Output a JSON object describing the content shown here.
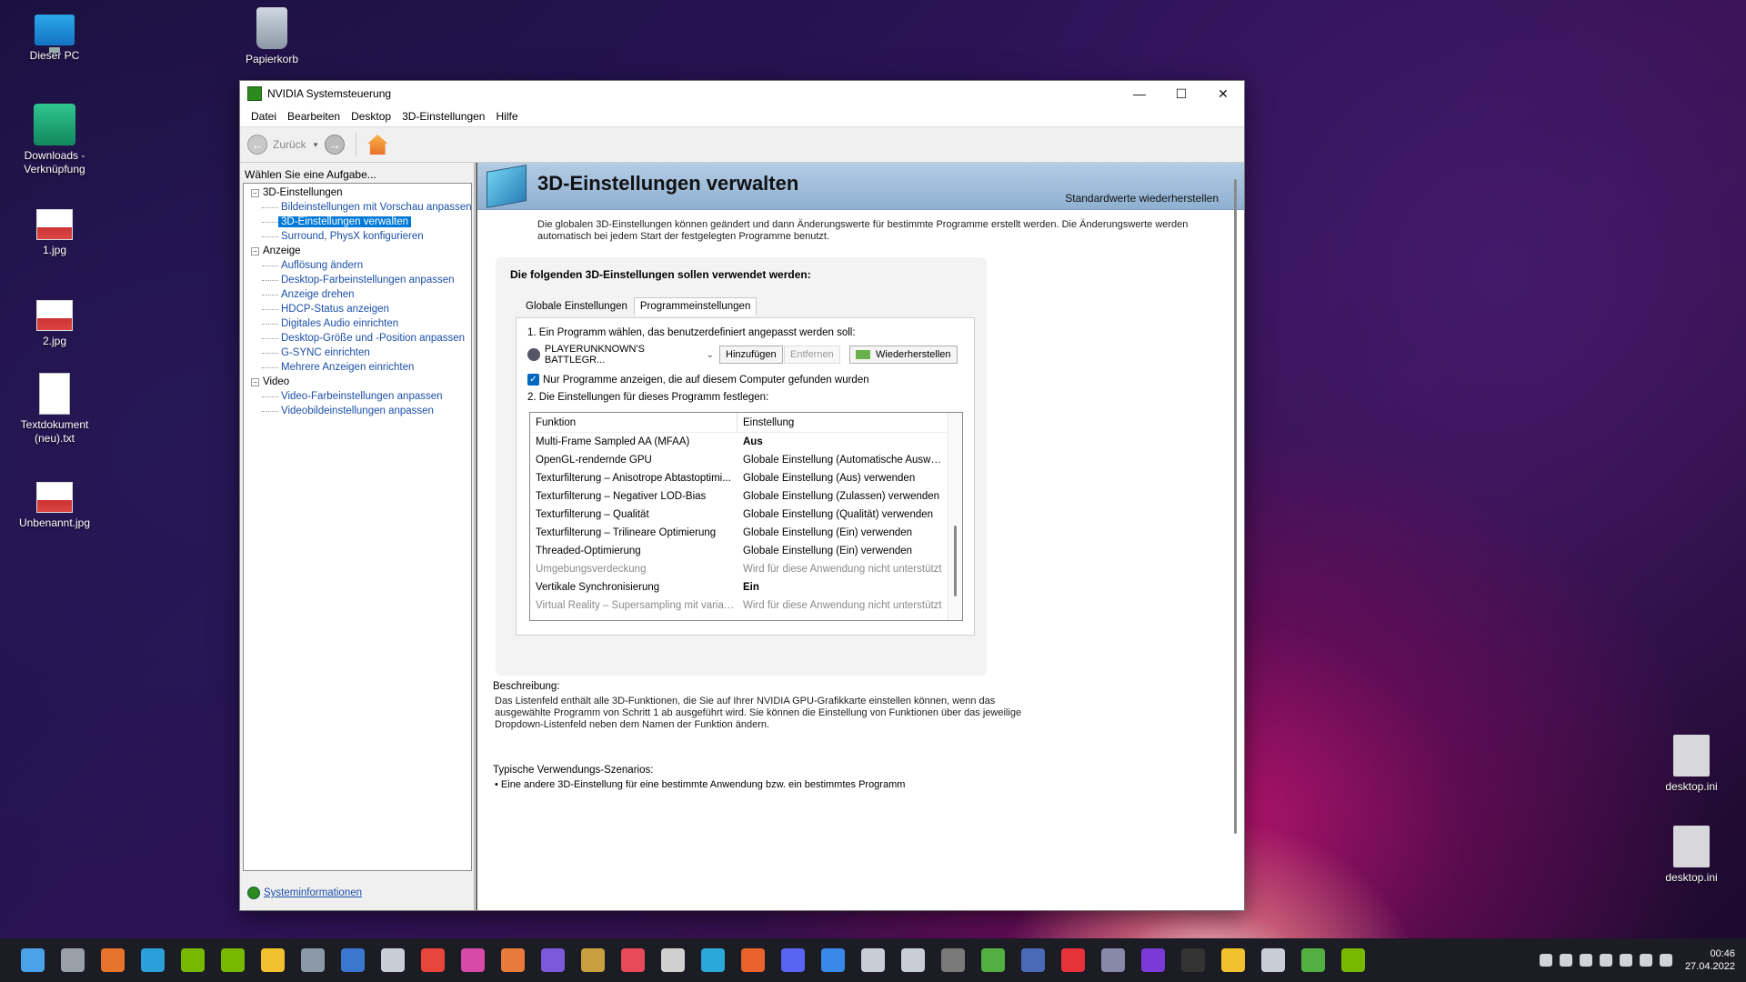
{
  "desktop": {
    "icons": [
      {
        "label": "Dieser PC"
      },
      {
        "label": "Papierkorb"
      },
      {
        "label": "Downloads - Verknüpfung"
      },
      {
        "label": "1.jpg"
      },
      {
        "label": "2.jpg"
      },
      {
        "label": "Textdokument (neu).txt"
      },
      {
        "label": "Unbenannt.jpg"
      },
      {
        "label": "desktop.ini"
      },
      {
        "label": "desktop.ini"
      }
    ]
  },
  "window": {
    "title": "NVIDIA Systemsteuerung",
    "controls": {
      "minimize": "—",
      "maximize": "☐",
      "close": "✕"
    },
    "menu": [
      "Datei",
      "Bearbeiten",
      "Desktop",
      "3D-Einstellungen",
      "Hilfe"
    ],
    "toolbar": {
      "back_label": "Zurück",
      "back_glyph": "←",
      "forward_glyph": "→",
      "dropdown_glyph": "▾"
    }
  },
  "sidebar": {
    "task_label": "Wählen Sie eine Aufgabe...",
    "categories": [
      {
        "label": "3D-Einstellungen",
        "items": [
          "Bildeinstellungen mit Vorschau anpassen",
          "3D-Einstellungen verwalten",
          "Surround, PhysX konfigurieren"
        ]
      },
      {
        "label": "Anzeige",
        "items": [
          "Auflösung ändern",
          "Desktop-Farbeinstellungen anpassen",
          "Anzeige drehen",
          "HDCP-Status anzeigen",
          "Digitales Audio einrichten",
          "Desktop-Größe und -Position anpassen",
          "G-SYNC einrichten",
          "Mehrere Anzeigen einrichten"
        ]
      },
      {
        "label": "Video",
        "items": [
          "Video-Farbeinstellungen anpassen",
          "Videobildeinstellungen anpassen"
        ]
      }
    ],
    "selected": "3D-Einstellungen verwalten",
    "tree_glyph": "−",
    "sysinfo": "Systeminformationen"
  },
  "main": {
    "title": "3D-Einstellungen verwalten",
    "reset": "Standardwerte wiederherstellen",
    "intro": "Die globalen 3D-Einstellungen können geändert und dann Änderungswerte für bestimmte Programme erstellt werden. Die Änderungswerte werden automatisch bei jedem Start der festgelegten Programme benutzt.",
    "panel_heading": "Die folgenden 3D-Einstellungen sollen verwendet werden:",
    "tabs": [
      "Globale Einstellungen",
      "Programmeinstellungen"
    ],
    "active_tab": 1,
    "step1": "1. Ein Programm wählen, das benutzerdefiniert angepasst werden soll:",
    "program": "PLAYERUNKNOWN'S BATTLEGR...",
    "caret_glyph": "⌄",
    "btn_add": "Hinzufügen",
    "btn_remove": "Entfernen",
    "btn_restore": "Wiederherstellen",
    "checkbox_label": "Nur Programme anzeigen, die auf diesem Computer gefunden wurden",
    "checkbox_glyph": "✓",
    "step2": "2. Die Einstellungen für dieses Programm festlegen:",
    "grid_headers": [
      "Funktion",
      "Einstellung"
    ],
    "grid_rows": [
      {
        "f": "Multi-Frame Sampled AA (MFAA)",
        "v": "Aus",
        "bold": true,
        "dim": false
      },
      {
        "f": "OpenGL-rendernde GPU",
        "v": "Globale Einstellung (Automatische Auswahl...",
        "bold": false,
        "dim": false
      },
      {
        "f": "Texturfilterung – Anisotrope Abtastoptimi...",
        "v": "Globale Einstellung (Aus) verwenden",
        "bold": false,
        "dim": false
      },
      {
        "f": "Texturfilterung – Negativer LOD-Bias",
        "v": "Globale Einstellung (Zulassen) verwenden",
        "bold": false,
        "dim": false
      },
      {
        "f": "Texturfilterung – Qualität",
        "v": "Globale Einstellung (Qualität) verwenden",
        "bold": false,
        "dim": false
      },
      {
        "f": "Texturfilterung – Trilineare Optimierung",
        "v": "Globale Einstellung (Ein) verwenden",
        "bold": false,
        "dim": false
      },
      {
        "f": "Threaded-Optimierung",
        "v": "Globale Einstellung (Ein) verwenden",
        "bold": false,
        "dim": false
      },
      {
        "f": "Umgebungsverdeckung",
        "v": "Wird für diese Anwendung nicht unterstützt",
        "bold": false,
        "dim": true
      },
      {
        "f": "Vertikale Synchronisierung",
        "v": "Ein",
        "bold": true,
        "dim": false
      },
      {
        "f": "Virtual Reality – Supersampling mit variabl...",
        "v": "Wird für diese Anwendung nicht unterstützt",
        "bold": false,
        "dim": true
      }
    ],
    "desc_heading": "Beschreibung:",
    "desc": "Das Listenfeld enthält alle 3D-Funktionen, die Sie auf Ihrer NVIDIA GPU-Grafikkarte einstellen können, wenn das ausgewählte Programm von Schritt 1 ab ausgeführt wird. Sie können die Einstellung von Funktionen über das jeweilige Dropdown-Listenfeld neben dem Namen der Funktion ändern.",
    "usage_heading": "Typische Verwendungs-Szenarios:",
    "usage_item": "• Eine andere 3D-Einstellung für eine bestimmte Anwendung bzw. ein bestimmtes Programm"
  },
  "taskbar": {
    "apps": [
      "start-icon",
      "taskview-icon",
      "adobe-icon",
      "app-icon",
      "nvidia-icon",
      "nvidia-icon",
      "file-explorer-icon",
      "settings-icon",
      "store-icon",
      "steam-icon",
      "app-icon",
      "app-icon",
      "app-icon",
      "app-icon",
      "app-icon",
      "app-icon",
      "app-icon",
      "edge-icon",
      "firefox-icon",
      "discord-icon",
      "search-icon",
      "video-icon",
      "video-icon",
      "obs-icon",
      "xbox-icon",
      "app-icon",
      "ea-icon",
      "ubisoft-icon",
      "app-icon",
      "epic-icon",
      "rockstar-icon",
      "steam-icon",
      "app-icon",
      "nvidia-icon"
    ],
    "time": "00:46",
    "date": "27.04.2022"
  },
  "colors": {
    "accent": "#0078d7",
    "nvidia": "#76b900",
    "link": "#1b4fa8"
  }
}
